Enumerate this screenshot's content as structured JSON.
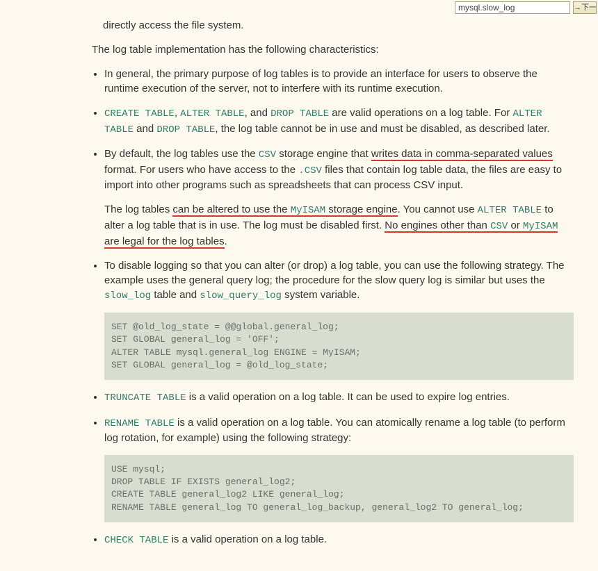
{
  "topbar": {
    "search_value": "mysql.slow_log",
    "next_label": "→下一"
  },
  "content": {
    "trailing_fragment": "directly access the file system.",
    "intro": "The log table implementation has the following characteristics:",
    "bullet1": "In general, the primary purpose of log tables is to provide an interface for users to observe the runtime execution of the server, not to interfere with its runtime execution.",
    "bullet2": {
      "create_table": "CREATE TABLE",
      "sep1": ", ",
      "alter_table": "ALTER TABLE",
      "sep2": ", and ",
      "drop_table": "DROP TABLE",
      "text1": " are valid operations on a log table. For ",
      "alter_table2": "ALTER TABLE",
      "text2": " and ",
      "drop_table2": "DROP TABLE",
      "text3": ", the log table cannot be in use and must be disabled, as described later."
    },
    "bullet3a": {
      "t1": "By default, the log tables use the ",
      "csv1": "CSV",
      "t2": " storage engine that ",
      "ul1": "writes data in comma-separated values",
      "t3": " format. For users who have access to the ",
      "dotcsv": ".CSV",
      "t4": " files that contain log table data, the files are easy to import into other programs such as spreadsheets that can process CSV input."
    },
    "bullet3b": {
      "t1": "The log tables ",
      "ul1": "can be altered to use the ",
      "myisam1": "MyISAM",
      "ul2": " storage engine",
      "t2": ". You cannot use ",
      "alter_table": "ALTER TABLE",
      "t3": " to alter a log table that is in use. The log must be disabled first. ",
      "ul3": "No engines other than ",
      "csv2": "CSV",
      "t4": " or ",
      "myisam2": "MyISAM",
      "ul4": " are legal for the log tables",
      "t5": "."
    },
    "bullet4": {
      "t1": "To disable logging so that you can alter (or drop) a log table, you can use the following strategy. The example uses the general query log; the procedure for the slow query log is similar but uses the ",
      "slow_log": "slow_log",
      "t2": " table and ",
      "slow_query_log": "slow_query_log",
      "t3": " system variable."
    },
    "codeblock1": "SET @old_log_state = @@global.general_log;\nSET GLOBAL general_log = 'OFF';\nALTER TABLE mysql.general_log ENGINE = MyISAM;\nSET GLOBAL general_log = @old_log_state;",
    "bullet5": {
      "truncate_table": "TRUNCATE TABLE",
      "t1": " is a valid operation on a log table. It can be used to expire log entries."
    },
    "bullet6": {
      "rename_table": "RENAME TABLE",
      "t1": " is a valid operation on a log table. You can atomically rename a log table (to perform log rotation, for example) using the following strategy:"
    },
    "codeblock2": "USE mysql;\nDROP TABLE IF EXISTS general_log2;\nCREATE TABLE general_log2 LIKE general_log;\nRENAME TABLE general_log TO general_log_backup, general_log2 TO general_log;",
    "bullet7": {
      "check_table": "CHECK TABLE",
      "t1": " is a valid operation on a log table."
    }
  }
}
